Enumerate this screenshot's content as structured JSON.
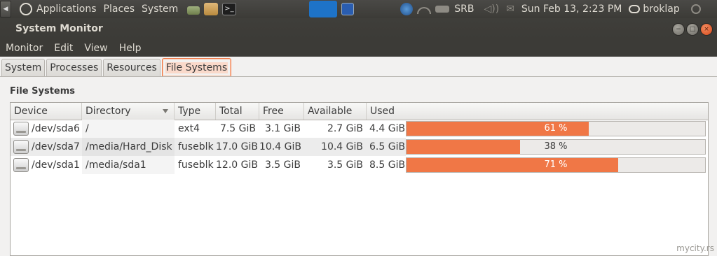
{
  "panel": {
    "applications": "Applications",
    "places": "Places",
    "system": "System",
    "keyboard_layout": "SRB",
    "datetime": "Sun Feb 13,  2:23 PM",
    "user": "broklap"
  },
  "window": {
    "title": "System Monitor"
  },
  "menu": [
    "Monitor",
    "Edit",
    "View",
    "Help"
  ],
  "tabs": [
    "System",
    "Processes",
    "Resources",
    "File Systems"
  ],
  "active_tab": "File Systems",
  "section_title": "File Systems",
  "table": {
    "columns": [
      "Device",
      "Directory",
      "Type",
      "Total",
      "Free",
      "Available",
      "Used"
    ],
    "rows": [
      {
        "device": "/dev/sda6",
        "directory": "/",
        "type": "ext4",
        "total": "7.5 GiB",
        "free": "3.1 GiB",
        "available": "2.7 GiB",
        "used": "4.4 GiB",
        "used_pct_label": "61 %",
        "used_fraction": 0.61
      },
      {
        "device": "/dev/sda7",
        "directory": "/media/Hard_Disk",
        "type": "fuseblk",
        "total": "17.0 GiB",
        "free": "10.4 GiB",
        "available": "10.4 GiB",
        "used": "6.5 GiB",
        "used_pct_label": "38 %",
        "used_fraction": 0.38
      },
      {
        "device": "/dev/sda1",
        "directory": "/media/sda1",
        "type": "fuseblk",
        "total": "12.0 GiB",
        "free": "3.5 GiB",
        "available": "3.5 GiB",
        "used": "8.5 GiB",
        "used_pct_label": "71 %",
        "used_fraction": 0.71
      }
    ]
  },
  "watermark": "mycity.rs",
  "colors": {
    "accent": "#f07746",
    "panel_bg": "#3c3b37"
  }
}
